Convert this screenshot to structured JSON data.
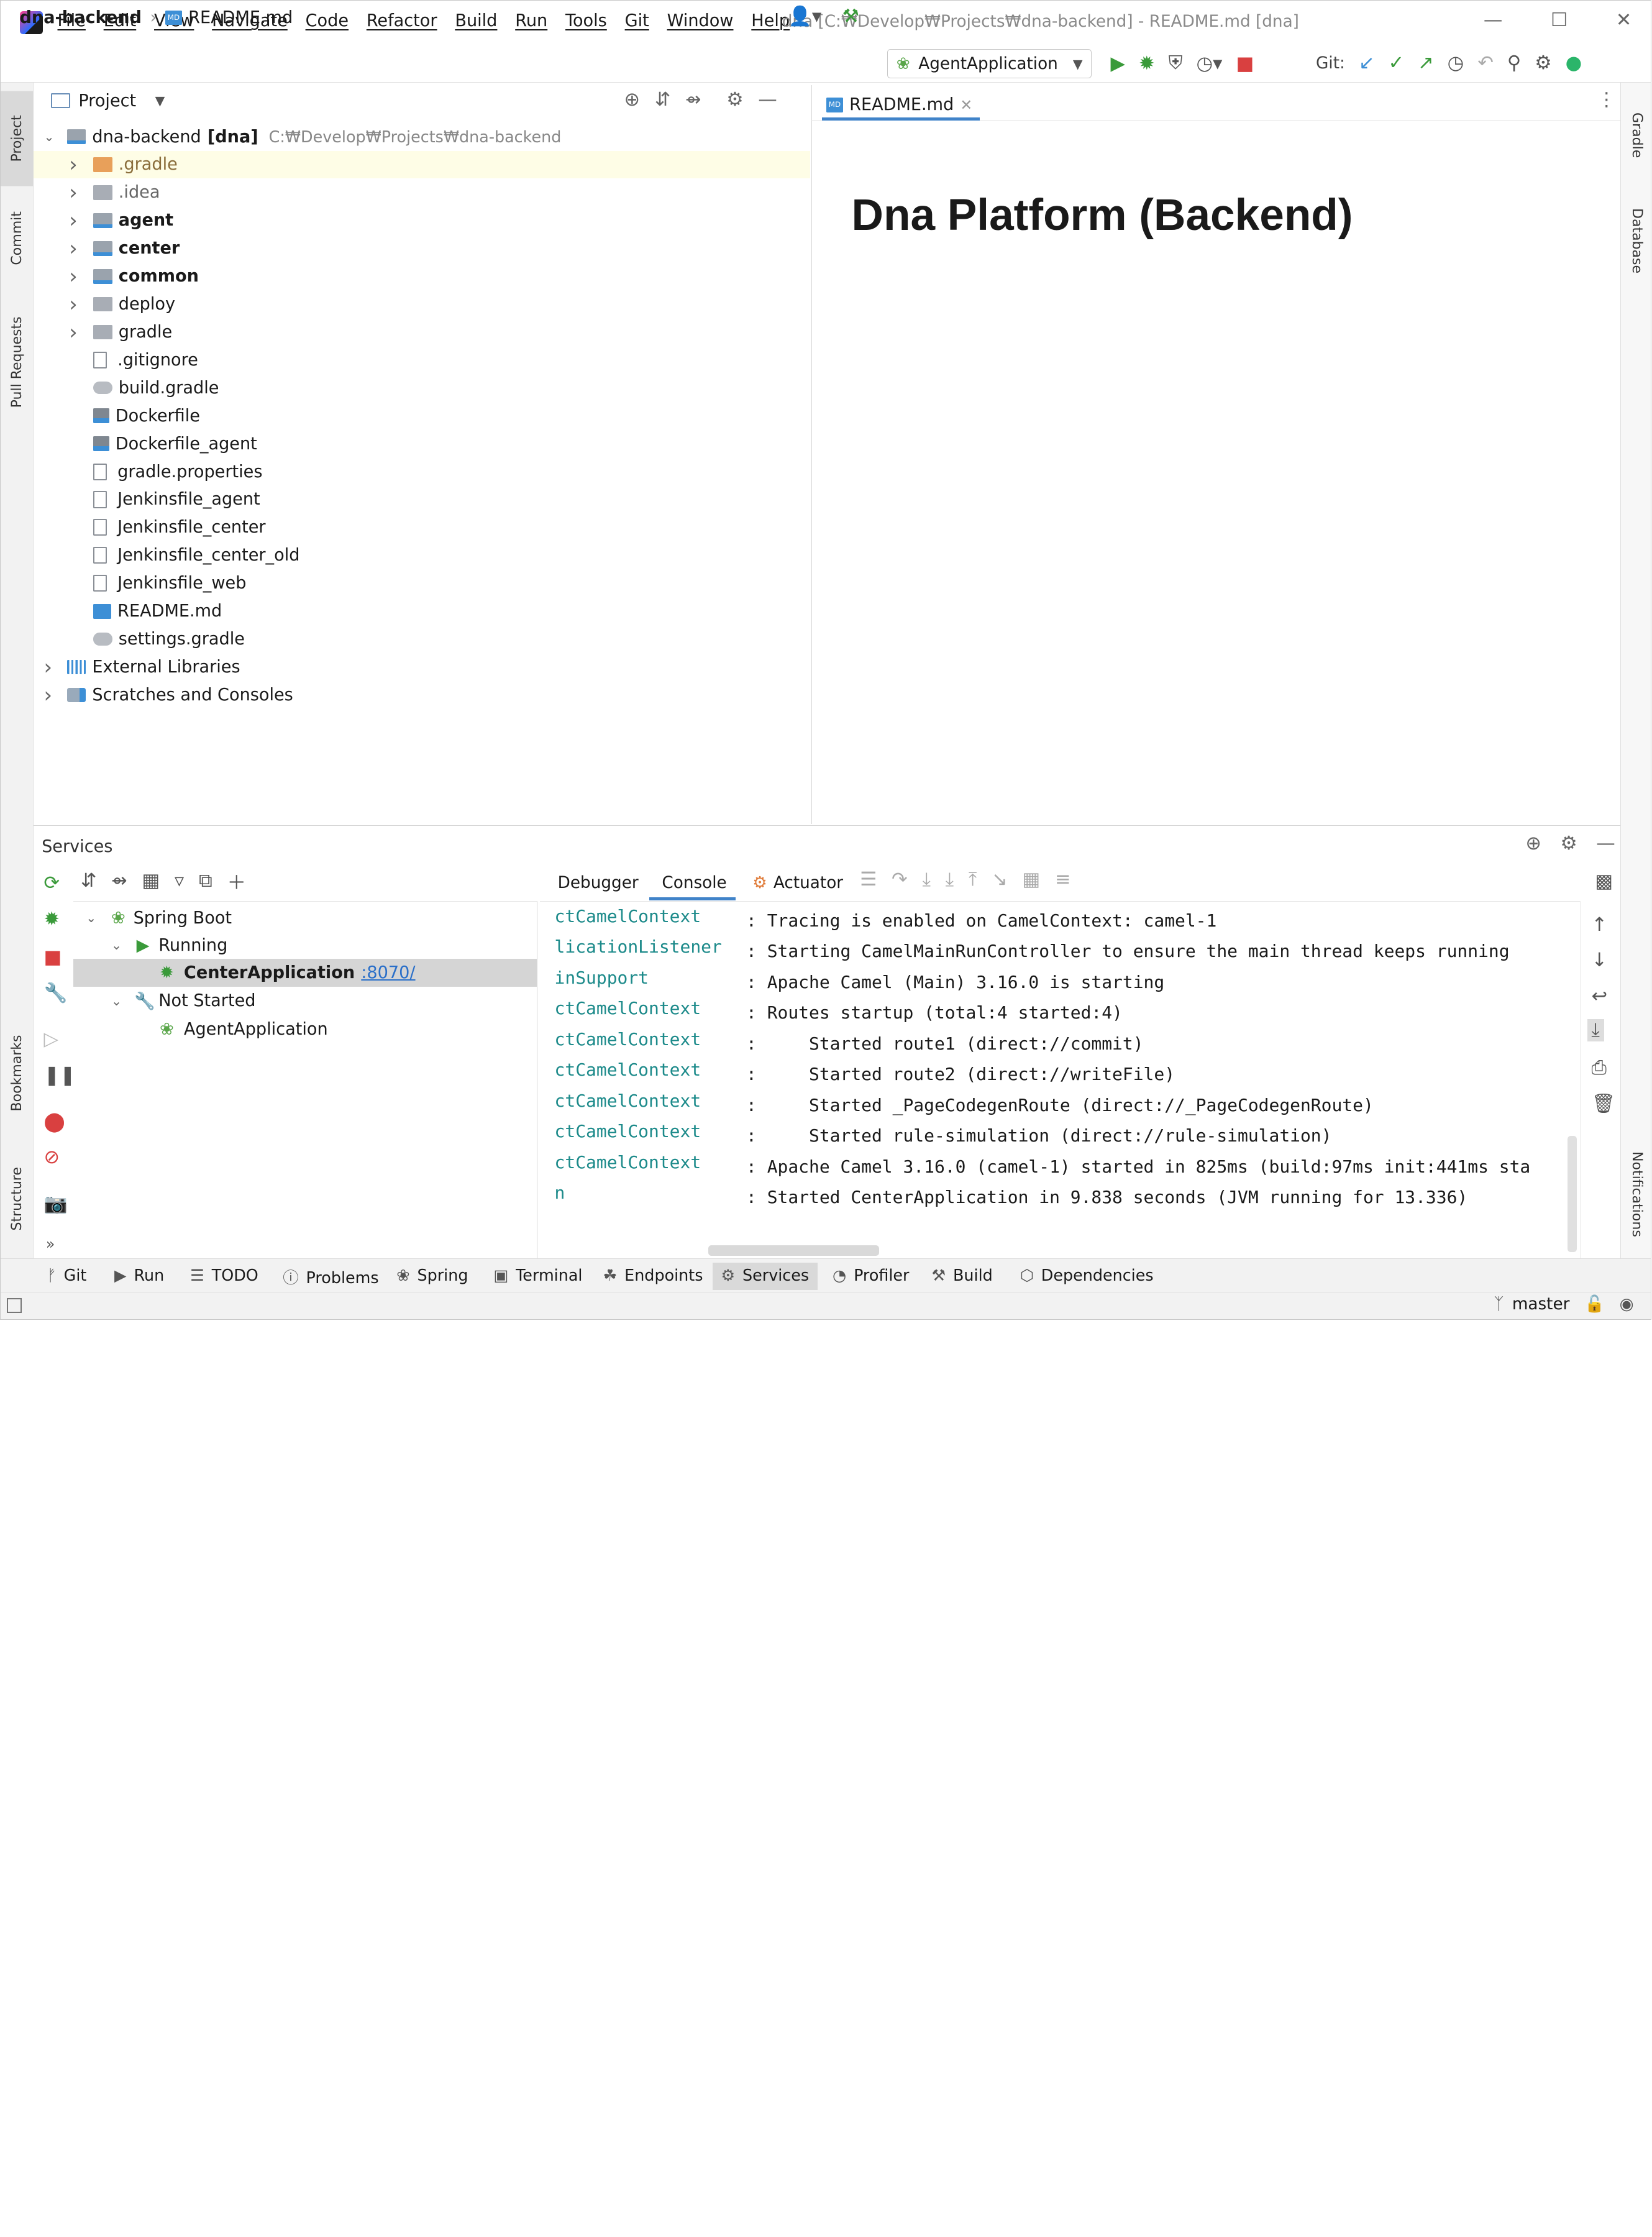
{
  "window": {
    "title": "dna [C:₩Develop₩Projects₩dna-backend] - README.md [dna]",
    "menu": [
      "File",
      "Edit",
      "View",
      "Navigate",
      "Code",
      "Refactor",
      "Build",
      "Run",
      "Tools",
      "Git",
      "Window",
      "Help"
    ]
  },
  "navbar": {
    "project": "dna-backend",
    "file": "README.md",
    "run_config": "AgentApplication",
    "git_label": "Git:"
  },
  "left_tabs": [
    "Project",
    "Commit",
    "Pull Requests",
    "Bookmarks",
    "Structure"
  ],
  "right_tabs": [
    "Gradle",
    "Database",
    "Notifications"
  ],
  "project_panel": {
    "title": "Project",
    "root": {
      "name": "dna-backend",
      "module": "[dna]",
      "path": "C:₩Develop₩Projects₩dna-backend"
    },
    "items": [
      {
        "label": ".gradle",
        "kind": "orange",
        "expandable": true,
        "bold": false
      },
      {
        "label": ".idea",
        "kind": "folder",
        "expandable": true,
        "bold": false
      },
      {
        "label": "agent",
        "kind": "mod",
        "expandable": true,
        "bold": true
      },
      {
        "label": "center",
        "kind": "mod",
        "expandable": true,
        "bold": true
      },
      {
        "label": "common",
        "kind": "mod",
        "expandable": true,
        "bold": true
      },
      {
        "label": "deploy",
        "kind": "folder",
        "expandable": true,
        "bold": false
      },
      {
        "label": "gradle",
        "kind": "folder",
        "expandable": true,
        "bold": false
      },
      {
        "label": ".gitignore",
        "kind": "file",
        "expandable": false,
        "bold": false
      },
      {
        "label": "build.gradle",
        "kind": "gradle",
        "expandable": false,
        "bold": false
      },
      {
        "label": "Dockerfile",
        "kind": "docker",
        "expandable": false,
        "bold": false
      },
      {
        "label": "Dockerfile_agent",
        "kind": "docker",
        "expandable": false,
        "bold": false
      },
      {
        "label": "gradle.properties",
        "kind": "file",
        "expandable": false,
        "bold": false
      },
      {
        "label": "Jenkinsfile_agent",
        "kind": "file",
        "expandable": false,
        "bold": false
      },
      {
        "label": "Jenkinsfile_center",
        "kind": "file",
        "expandable": false,
        "bold": false
      },
      {
        "label": "Jenkinsfile_center_old",
        "kind": "file",
        "expandable": false,
        "bold": false
      },
      {
        "label": "Jenkinsfile_web",
        "kind": "file",
        "expandable": false,
        "bold": false
      },
      {
        "label": "README.md",
        "kind": "md",
        "expandable": false,
        "bold": false
      },
      {
        "label": "settings.gradle",
        "kind": "gradle",
        "expandable": false,
        "bold": false
      }
    ],
    "external_libraries": "External Libraries",
    "scratches": "Scratches and Consoles"
  },
  "editor": {
    "tab_label": "README.md",
    "heading": "Dna Platform (Backend)"
  },
  "services": {
    "title": "Services",
    "tree": {
      "spring_boot": "Spring Boot",
      "running": "Running",
      "center_app": "CenterApplication",
      "center_port": ":8070/",
      "not_started": "Not Started",
      "agent_app": "AgentApplication"
    },
    "tabs": [
      "Debugger",
      "Console",
      "Actuator"
    ],
    "active_tab": "Console",
    "console_lines": [
      {
        "src": "ctCamelContext",
        "msg": ": Tracing is enabled on CamelContext: camel-1"
      },
      {
        "src": "licationListener",
        "msg": ": Starting CamelMainRunController to ensure the main thread keeps running"
      },
      {
        "src": "inSupport",
        "msg": ": Apache Camel (Main) 3.16.0 is starting"
      },
      {
        "src": "ctCamelContext",
        "msg": ": Routes startup (total:4 started:4)"
      },
      {
        "src": "ctCamelContext",
        "msg": ":     Started route1 (direct://commit)"
      },
      {
        "src": "ctCamelContext",
        "msg": ":     Started route2 (direct://writeFile)"
      },
      {
        "src": "ctCamelContext",
        "msg": ":     Started _PageCodegenRoute (direct://_PageCodegenRoute)"
      },
      {
        "src": "ctCamelContext",
        "msg": ":     Started rule-simulation (direct://rule-simulation)"
      },
      {
        "src": "ctCamelContext",
        "msg": ": Apache Camel 3.16.0 (camel-1) started in 825ms (build:97ms init:441ms sta"
      },
      {
        "src": "n",
        "msg": ": Started CenterApplication in 9.838 seconds (JVM running for 13.336)"
      }
    ]
  },
  "bottom_tabs": [
    "Git",
    "Run",
    "TODO",
    "Problems",
    "Spring",
    "Terminal",
    "Endpoints",
    "Services",
    "Profiler",
    "Build",
    "Dependencies"
  ],
  "bottom_active": "Services",
  "status": {
    "branch": "master"
  },
  "colors": {
    "accent": "#4083c9",
    "console_source": "#1c8a8a",
    "run_green": "#3a9a3a",
    "stop_red": "#d94040",
    "selection": "#d5d5d5",
    "highlight_row": "#fefde6"
  }
}
